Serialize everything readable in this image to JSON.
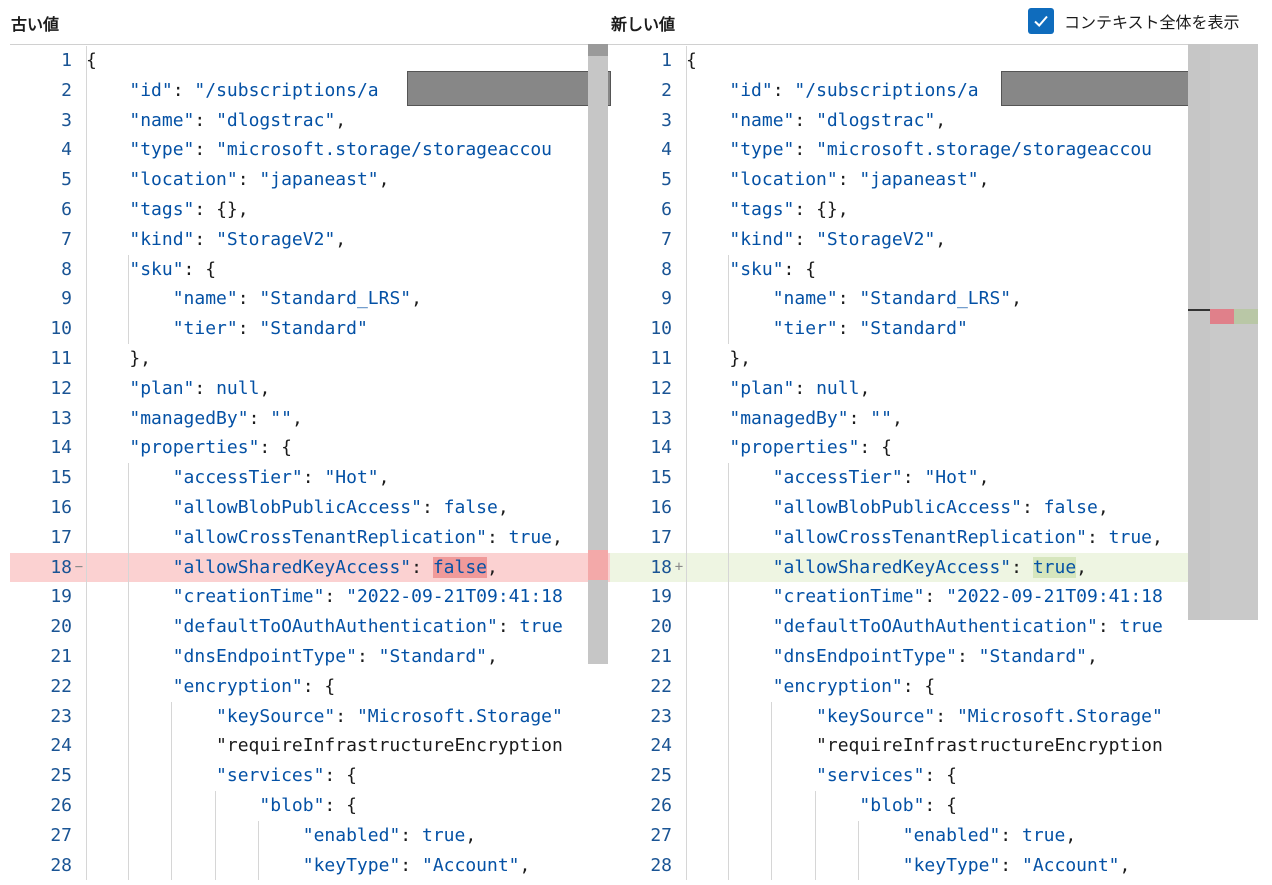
{
  "header": {
    "old_label": "古い値",
    "new_label": "新しい値",
    "context_checkbox": {
      "label": "コンテキスト全体を表示",
      "checked": true
    },
    "accent_color": "#0f6cbd"
  },
  "colors": {
    "removed_bg": "#fbd1d1",
    "added_bg": "#eef5e2",
    "token": "#0451a5",
    "line_number": "#1a5494"
  },
  "old": {
    "lines": [
      {
        "n": "1",
        "mark": "",
        "code": "{"
      },
      {
        "n": "2",
        "mark": "",
        "code": "    \"id\": \"/subscriptions/a"
      },
      {
        "n": "3",
        "mark": "",
        "code": "    \"name\": \"dlogstrac\","
      },
      {
        "n": "4",
        "mark": "",
        "code": "    \"type\": \"microsoft.storage/storageaccou"
      },
      {
        "n": "5",
        "mark": "",
        "code": "    \"location\": \"japaneast\","
      },
      {
        "n": "6",
        "mark": "",
        "code": "    \"tags\": {},"
      },
      {
        "n": "7",
        "mark": "",
        "code": "    \"kind\": \"StorageV2\","
      },
      {
        "n": "8",
        "mark": "",
        "code": "    \"sku\": {"
      },
      {
        "n": "9",
        "mark": "",
        "code": "        \"name\": \"Standard_LRS\","
      },
      {
        "n": "10",
        "mark": "",
        "code": "        \"tier\": \"Standard\""
      },
      {
        "n": "11",
        "mark": "",
        "code": "    },"
      },
      {
        "n": "12",
        "mark": "",
        "code": "    \"plan\": null,"
      },
      {
        "n": "13",
        "mark": "",
        "code": "    \"managedBy\": \"\","
      },
      {
        "n": "14",
        "mark": "",
        "code": "    \"properties\": {"
      },
      {
        "n": "15",
        "mark": "",
        "code": "        \"accessTier\": \"Hot\","
      },
      {
        "n": "16",
        "mark": "",
        "code": "        \"allowBlobPublicAccess\": false,"
      },
      {
        "n": "17",
        "mark": "",
        "code": "        \"allowCrossTenantReplication\": true,"
      },
      {
        "n": "18",
        "mark": "−",
        "code": "        \"allowSharedKeyAccess\": false,",
        "state": "removed"
      },
      {
        "n": "19",
        "mark": "",
        "code": "        \"creationTime\": \"2022-09-21T09:41:18"
      },
      {
        "n": "20",
        "mark": "",
        "code": "        \"defaultToOAuthAuthentication\": true"
      },
      {
        "n": "21",
        "mark": "",
        "code": "        \"dnsEndpointType\": \"Standard\","
      },
      {
        "n": "22",
        "mark": "",
        "code": "        \"encryption\": {"
      },
      {
        "n": "23",
        "mark": "",
        "code": "            \"keySource\": \"Microsoft.Storage\""
      },
      {
        "n": "24",
        "mark": "",
        "code": "            \"requireInfrastructureEncryption"
      },
      {
        "n": "25",
        "mark": "",
        "code": "            \"services\": {"
      },
      {
        "n": "26",
        "mark": "",
        "code": "                \"blob\": {"
      },
      {
        "n": "27",
        "mark": "",
        "code": "                    \"enabled\": true,"
      },
      {
        "n": "28",
        "mark": "",
        "code": "                    \"keyType\": \"Account\","
      }
    ]
  },
  "new": {
    "lines": [
      {
        "n": "1",
        "mark": "",
        "code": "{"
      },
      {
        "n": "2",
        "mark": "",
        "code": "    \"id\": \"/subscriptions/a"
      },
      {
        "n": "3",
        "mark": "",
        "code": "    \"name\": \"dlogstrac\","
      },
      {
        "n": "4",
        "mark": "",
        "code": "    \"type\": \"microsoft.storage/storageaccou"
      },
      {
        "n": "5",
        "mark": "",
        "code": "    \"location\": \"japaneast\","
      },
      {
        "n": "6",
        "mark": "",
        "code": "    \"tags\": {},"
      },
      {
        "n": "7",
        "mark": "",
        "code": "    \"kind\": \"StorageV2\","
      },
      {
        "n": "8",
        "mark": "",
        "code": "    \"sku\": {"
      },
      {
        "n": "9",
        "mark": "",
        "code": "        \"name\": \"Standard_LRS\","
      },
      {
        "n": "10",
        "mark": "",
        "code": "        \"tier\": \"Standard\""
      },
      {
        "n": "11",
        "mark": "",
        "code": "    },"
      },
      {
        "n": "12",
        "mark": "",
        "code": "    \"plan\": null,"
      },
      {
        "n": "13",
        "mark": "",
        "code": "    \"managedBy\": \"\","
      },
      {
        "n": "14",
        "mark": "",
        "code": "    \"properties\": {"
      },
      {
        "n": "15",
        "mark": "",
        "code": "        \"accessTier\": \"Hot\","
      },
      {
        "n": "16",
        "mark": "",
        "code": "        \"allowBlobPublicAccess\": false,"
      },
      {
        "n": "17",
        "mark": "",
        "code": "        \"allowCrossTenantReplication\": true,"
      },
      {
        "n": "18",
        "mark": "+",
        "code": "        \"allowSharedKeyAccess\": true,",
        "state": "added"
      },
      {
        "n": "19",
        "mark": "",
        "code": "        \"creationTime\": \"2022-09-21T09:41:18"
      },
      {
        "n": "20",
        "mark": "",
        "code": "        \"defaultToOAuthAuthentication\": true"
      },
      {
        "n": "21",
        "mark": "",
        "code": "        \"dnsEndpointType\": \"Standard\","
      },
      {
        "n": "22",
        "mark": "",
        "code": "        \"encryption\": {"
      },
      {
        "n": "23",
        "mark": "",
        "code": "            \"keySource\": \"Microsoft.Storage\""
      },
      {
        "n": "24",
        "mark": "",
        "code": "            \"requireInfrastructureEncryption"
      },
      {
        "n": "25",
        "mark": "",
        "code": "            \"services\": {"
      },
      {
        "n": "26",
        "mark": "",
        "code": "                \"blob\": {"
      },
      {
        "n": "27",
        "mark": "",
        "code": "                    \"enabled\": true,"
      },
      {
        "n": "28",
        "mark": "",
        "code": "                    \"keyType\": \"Account\","
      }
    ]
  }
}
